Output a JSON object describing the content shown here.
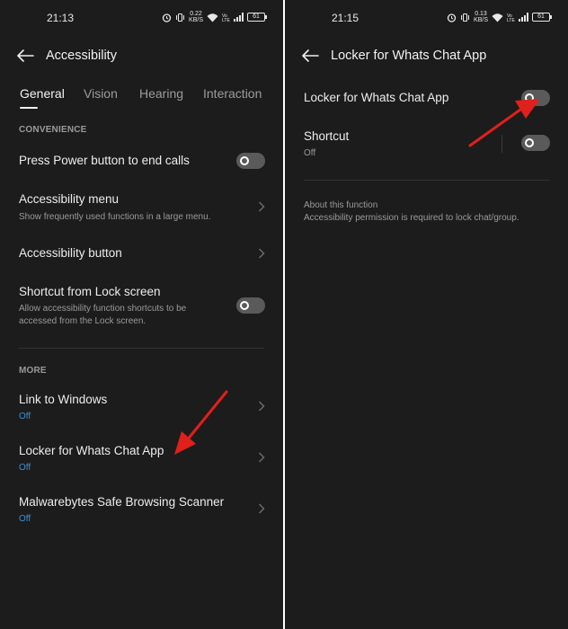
{
  "left": {
    "status": {
      "time": "21:13",
      "speed": "0.22",
      "speed_unit": "KB/S",
      "battery": "61"
    },
    "header": {
      "title": "Accessibility"
    },
    "tabs": [
      {
        "label": "General"
      },
      {
        "label": "Vision"
      },
      {
        "label": "Hearing"
      },
      {
        "label": "Interaction"
      }
    ],
    "sections": {
      "convenience": "CONVENIENCE",
      "more": "MORE"
    },
    "items": {
      "power_button": {
        "label": "Press Power button to end calls",
        "enabled": false
      },
      "accessibility_menu": {
        "label": "Accessibility menu",
        "description": "Show frequently used functions in a large menu."
      },
      "accessibility_button": {
        "label": "Accessibility button"
      },
      "shortcut_lock": {
        "label": "Shortcut from Lock screen",
        "description_line1": "Allow accessibility function shortcuts to be",
        "description_line2": "accessed from the Lock screen.",
        "enabled": false
      },
      "link_windows": {
        "label": "Link to Windows",
        "status": "Off"
      },
      "locker": {
        "label": "Locker for Whats Chat App",
        "status": "Off"
      },
      "malwarebytes": {
        "label": "Malwarebytes Safe Browsing Scanner",
        "status": "Off"
      }
    }
  },
  "right": {
    "status": {
      "time": "21:15",
      "speed": "0.13",
      "speed_unit": "KB/S",
      "battery": "61"
    },
    "header": {
      "title": "Locker for Whats Chat App"
    },
    "items": {
      "locker_toggle": {
        "label": "Locker for Whats Chat App",
        "enabled": false
      },
      "shortcut": {
        "label": "Shortcut",
        "status": "Off",
        "enabled": false
      }
    },
    "about": {
      "title": "About this function",
      "description": "Accessibility permission is required to lock chat/group."
    }
  },
  "colors": {
    "background": "#1c1c1c",
    "status_off_link": "#3d8fd1",
    "annotation_arrow": "#e0201b"
  }
}
